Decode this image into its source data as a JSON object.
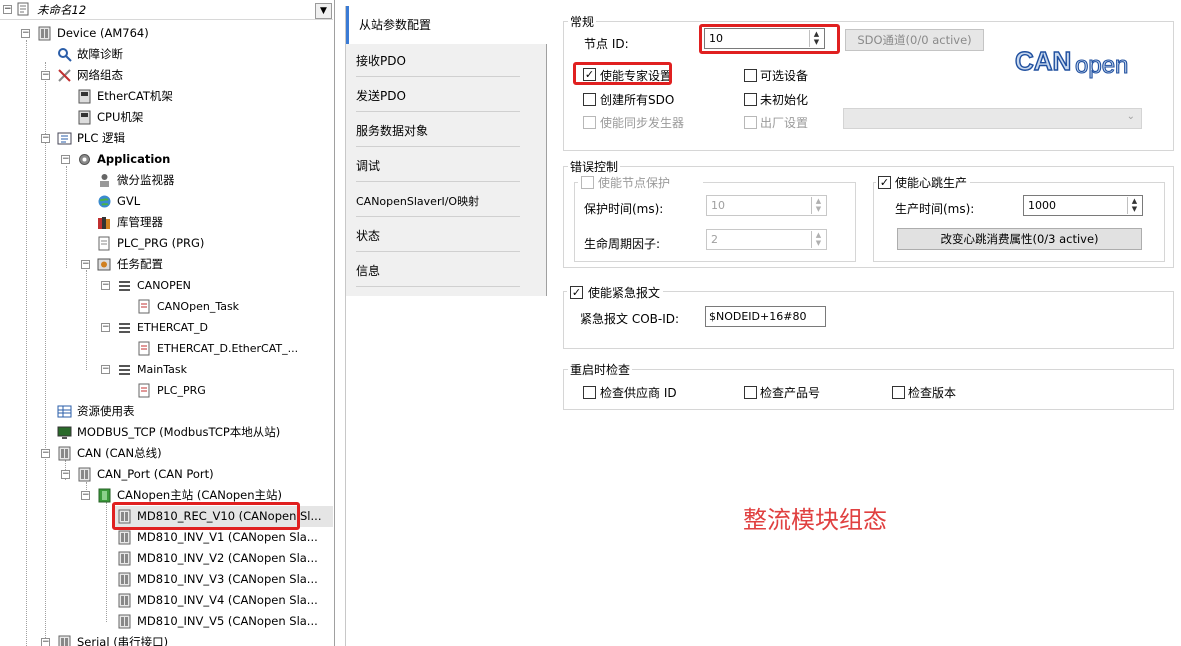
{
  "tree": {
    "project_name": "未命名12",
    "items": [
      {
        "label": "Device (AM764)"
      },
      {
        "label": "故障诊断"
      },
      {
        "label": "网络组态"
      },
      {
        "label": "EtherCAT机架"
      },
      {
        "label": "CPU机架"
      },
      {
        "label": "PLC 逻辑"
      },
      {
        "label": "Application"
      },
      {
        "label": "微分监视器"
      },
      {
        "label": "GVL"
      },
      {
        "label": "库管理器"
      },
      {
        "label": "PLC_PRG (PRG)"
      },
      {
        "label": "任务配置"
      },
      {
        "label": "CANOPEN"
      },
      {
        "label": "CANOpen_Task"
      },
      {
        "label": "ETHERCAT_D"
      },
      {
        "label": "ETHERCAT_D.EtherCAT_..."
      },
      {
        "label": "MainTask"
      },
      {
        "label": "PLC_PRG"
      },
      {
        "label": "资源使用表"
      },
      {
        "label": "MODBUS_TCP (ModbusTCP本地从站)"
      },
      {
        "label": "CAN (CAN总线)"
      },
      {
        "label": "CAN_Port (CAN Port)"
      },
      {
        "label": "CANopen主站 (CANopen主站)"
      },
      {
        "label": "MD810_REC_V10 (CANopen Sl..."
      },
      {
        "label": "MD810_INV_V1 (CANopen Sla..."
      },
      {
        "label": "MD810_INV_V2 (CANopen Sla..."
      },
      {
        "label": "MD810_INV_V3 (CANopen Sla..."
      },
      {
        "label": "MD810_INV_V4 (CANopen Sla..."
      },
      {
        "label": "MD810_INV_V5 (CANopen Sla..."
      },
      {
        "label": "Serial (串行接口)"
      }
    ]
  },
  "tabs": [
    {
      "label": "从站参数配置"
    },
    {
      "label": "接收PDO"
    },
    {
      "label": "发送PDO"
    },
    {
      "label": "服务数据对象"
    },
    {
      "label": "调试"
    },
    {
      "label": "CANopenSlaverI/O映射"
    },
    {
      "label": "状态"
    },
    {
      "label": "信息"
    }
  ],
  "general": {
    "title": "常规",
    "node_id_label": "节点 ID:",
    "node_id_value": "10",
    "sdo_button": "SDO通道(0/0 active)",
    "expert_settings": "使能专家设置",
    "optional_device": "可选设备",
    "create_all_sdo": "创建所有SDO",
    "no_init": "未初始化",
    "enable_sync": "使能同步发生器",
    "factory_settings": "出厂设置"
  },
  "logo": {
    "text_can": "CAN",
    "text_open": "open"
  },
  "error_control": {
    "title": "错误控制",
    "node_guard_label": "使能节点保护",
    "guard_time_label": "保护时间(ms):",
    "guard_time_value": "10",
    "life_factor_label": "生命周期因子:",
    "life_factor_value": "2",
    "heartbeat_label": "使能心跳生产",
    "produce_time_label": "生产时间(ms):",
    "produce_time_value": "1000",
    "heartbeat_button": "改变心跳消费属性(0/3 active)"
  },
  "emergency": {
    "title": "使能紧急报文",
    "cob_id_label": "紧急报文 COB-ID:",
    "cob_id_value": "$NODEID+16#80"
  },
  "restart": {
    "title": "重启时检查",
    "vendor_id": "检查供应商 ID",
    "product_no": "检查产品号",
    "version": "检查版本"
  },
  "caption": "整流模块组态"
}
